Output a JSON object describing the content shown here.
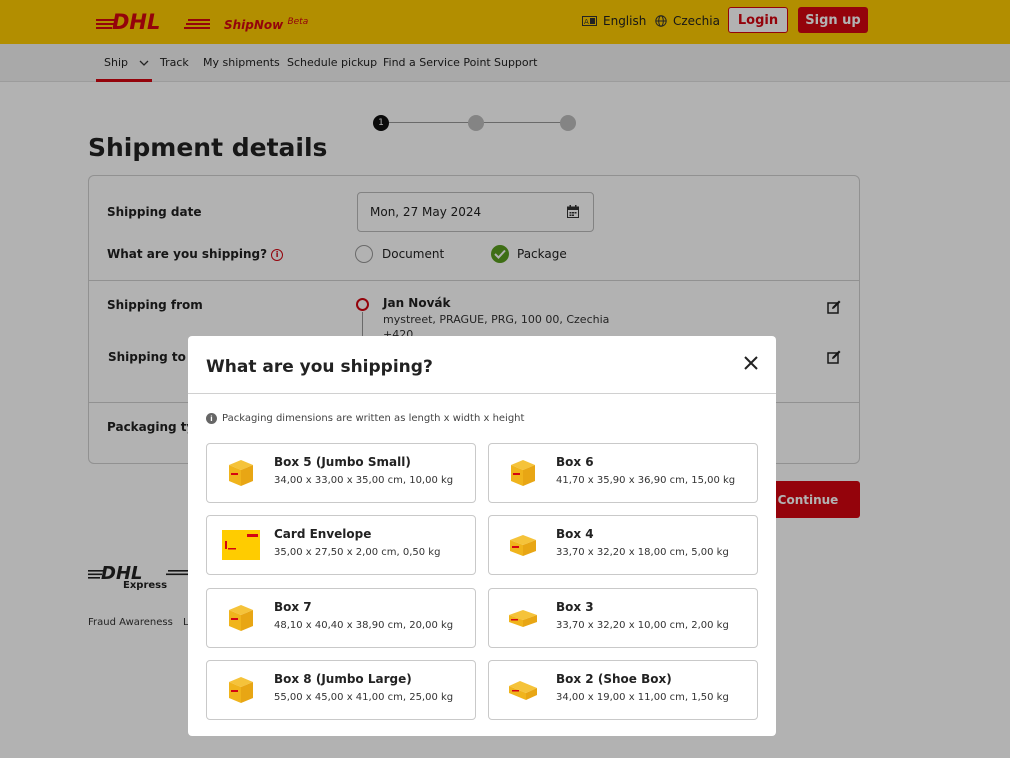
{
  "header": {
    "brand": "DHL",
    "product": "ShipNow",
    "product_badge": "Beta",
    "language": "English",
    "country": "Czechia",
    "login_label": "Login",
    "signup_label": "Sign up"
  },
  "nav": {
    "items": [
      "Ship",
      "Track",
      "My shipments",
      "Schedule pickup",
      "Find a Service Point",
      "Support"
    ]
  },
  "stepper": {
    "current": "1"
  },
  "page_title": "Shipment details",
  "form": {
    "shipping_date_label": "Shipping date",
    "shipping_date_value": "Mon, 27 May 2024",
    "what_shipping_label": "What are you shipping?",
    "option_document": "Document",
    "option_package": "Package",
    "shipping_from_label": "Shipping from",
    "from_name": "Jan Novák",
    "from_address": "mystreet, PRAGUE, PRG, 100 00, Czechia",
    "from_phone": "+420",
    "shipping_to_label": "Shipping to",
    "packaging_type_label": "Packaging typ"
  },
  "continue_label": "Continue",
  "footer": {
    "express": "Express",
    "link_fraud": "Fraud Awareness",
    "link_partial": "L"
  },
  "modal": {
    "title": "What are you shipping?",
    "note": "Packaging dimensions are written as length x width x height",
    "options": [
      {
        "name": "Box 5 (Jumbo Small)",
        "dims": "34,00 x 33,00 x 35,00 cm, 10,00 kg",
        "icon": "box-icon"
      },
      {
        "name": "Box 6",
        "dims": "41,70 x 35,90 x 36,90 cm, 15,00 kg",
        "icon": "box-icon"
      },
      {
        "name": "Card Envelope",
        "dims": "35,00 x 27,50 x 2,00 cm, 0,50 kg",
        "icon": "envelope-icon"
      },
      {
        "name": "Box 4",
        "dims": "33,70 x 32,20 x 18,00 cm, 5,00 kg",
        "icon": "box-icon"
      },
      {
        "name": "Box 7",
        "dims": "48,10 x 40,40 x 38,90 cm, 20,00 kg",
        "icon": "box-icon"
      },
      {
        "name": "Box 3",
        "dims": "33,70 x 32,20 x 10,00 cm, 2,00 kg",
        "icon": "flat-box-icon"
      },
      {
        "name": "Box 8 (Jumbo Large)",
        "dims": "55,00 x 45,00 x 41,00 cm, 25,00 kg",
        "icon": "box-icon"
      },
      {
        "name": "Box 2 (Shoe Box)",
        "dims": "34,00 x 19,00 x 11,00 cm, 1,50 kg",
        "icon": "flat-box-icon"
      }
    ]
  },
  "colors": {
    "brand_yellow": "#ffcc00",
    "brand_red": "#d40511",
    "success_green": "#5a9e1f"
  }
}
